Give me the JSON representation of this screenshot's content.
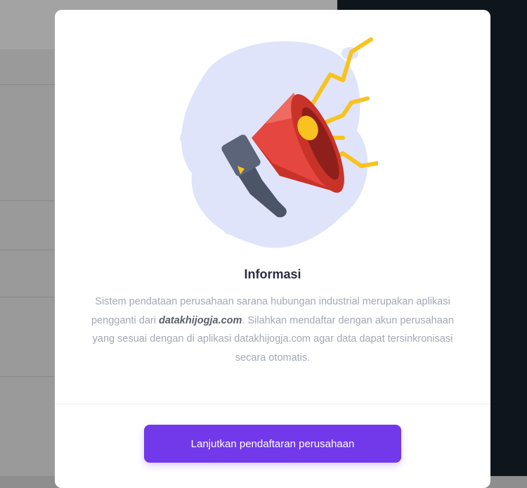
{
  "modal": {
    "title": "Informasi",
    "body_part1": "Sistem pendataan perusahaan sarana hubungan industrial merupakan aplikasi pengganti dari ",
    "body_site": "datakhijogja.com",
    "body_part2": ". Silahkan mendaftar dengan akun perusahaan yang sesuai dengan di aplikasi datakhijogja.com agar data dapat tersinkronisasi secara otomatis.",
    "continue_button_label": "Lanjutkan pendaftaran perusahaan",
    "illustration_icon": "megaphone-icon"
  },
  "colors": {
    "button_accent": "#7239ea",
    "title_text": "#2b2d42",
    "body_text": "#a3a8b5",
    "backdrop_blob": "#dfe4fb",
    "megaphone_red": "#e5463f",
    "megaphone_yellow": "#f8c31f",
    "handle_gray": "#4c5467"
  }
}
